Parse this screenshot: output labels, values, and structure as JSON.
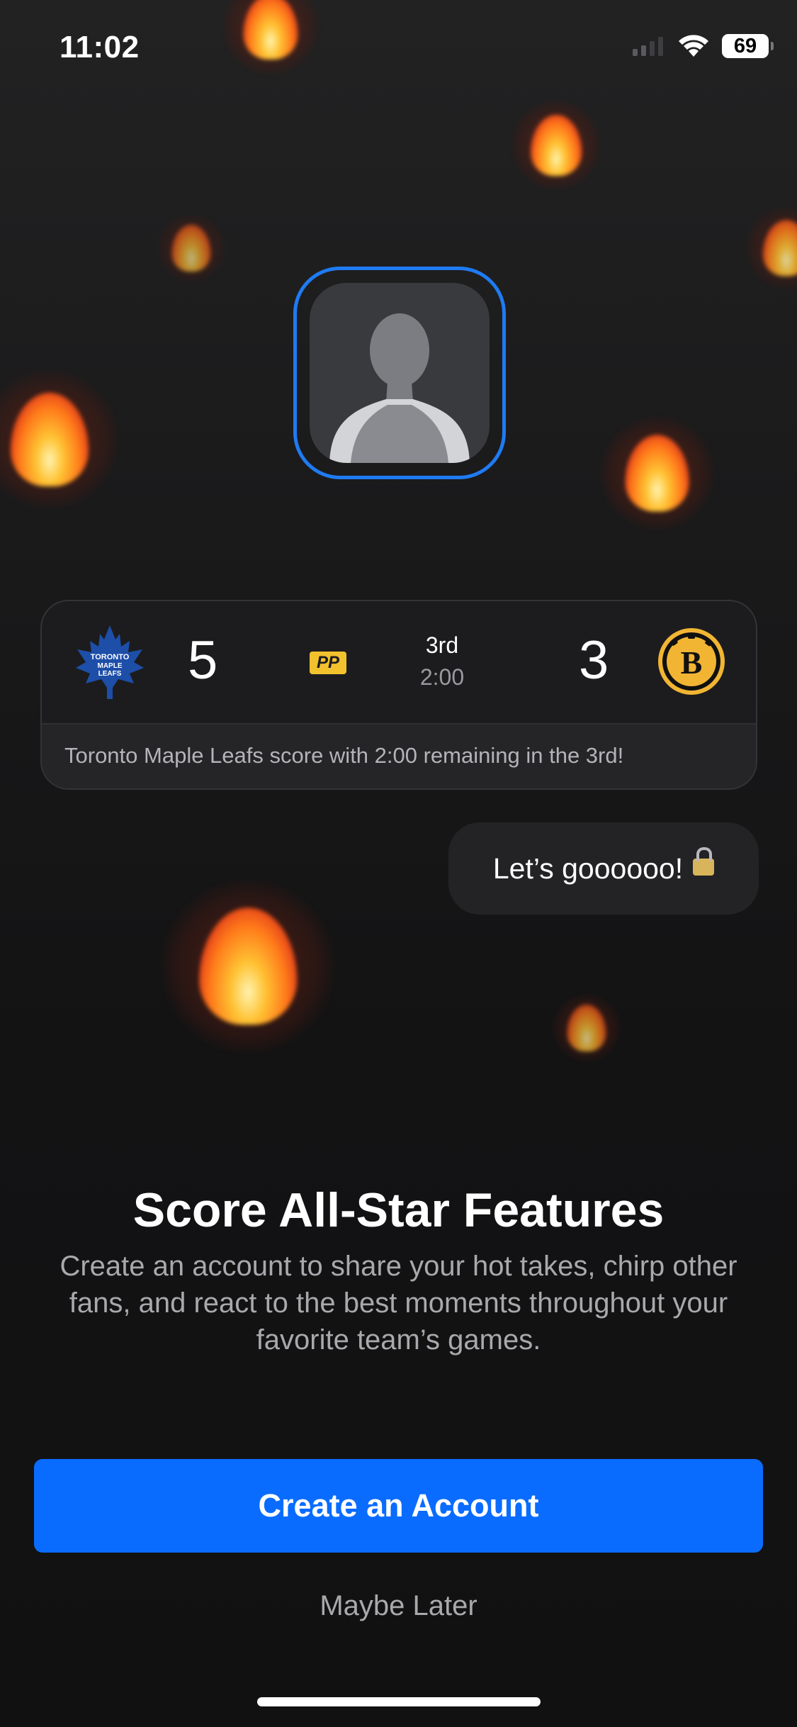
{
  "status_bar": {
    "time": "11:02",
    "battery_level": "69",
    "icons": [
      "signal-icon",
      "wifi-icon",
      "battery-icon"
    ]
  },
  "score_card": {
    "home_team": "Toronto Maple Leafs",
    "home_logo_text": "TORONTO MAPLE LEAFS",
    "home_score": "5",
    "away_team": "Boston Bruins",
    "away_logo_text": "B",
    "away_score": "3",
    "power_play_badge": "PP",
    "period": "3rd",
    "clock": "2:00",
    "message": "Toronto Maple Leafs score with 2:00 remaining in the 3rd!"
  },
  "chat": {
    "bubble_text": "Let’s goooooo!",
    "trailing_icon": "lock-icon"
  },
  "onboarding": {
    "title": "Score All-Star Features",
    "description": "Create an account to share your hot takes, chirp other fans, and react to the best moments throughout your favorite team’s games."
  },
  "actions": {
    "primary_label": "Create an Account",
    "secondary_label": "Maybe Later"
  },
  "colors": {
    "accent": "#0a6cff",
    "avatar_ring": "#1f7bf2",
    "pp_badge": "#f2c12e",
    "leafs_blue": "#1d4ea8",
    "bruins_gold": "#f2b533"
  }
}
